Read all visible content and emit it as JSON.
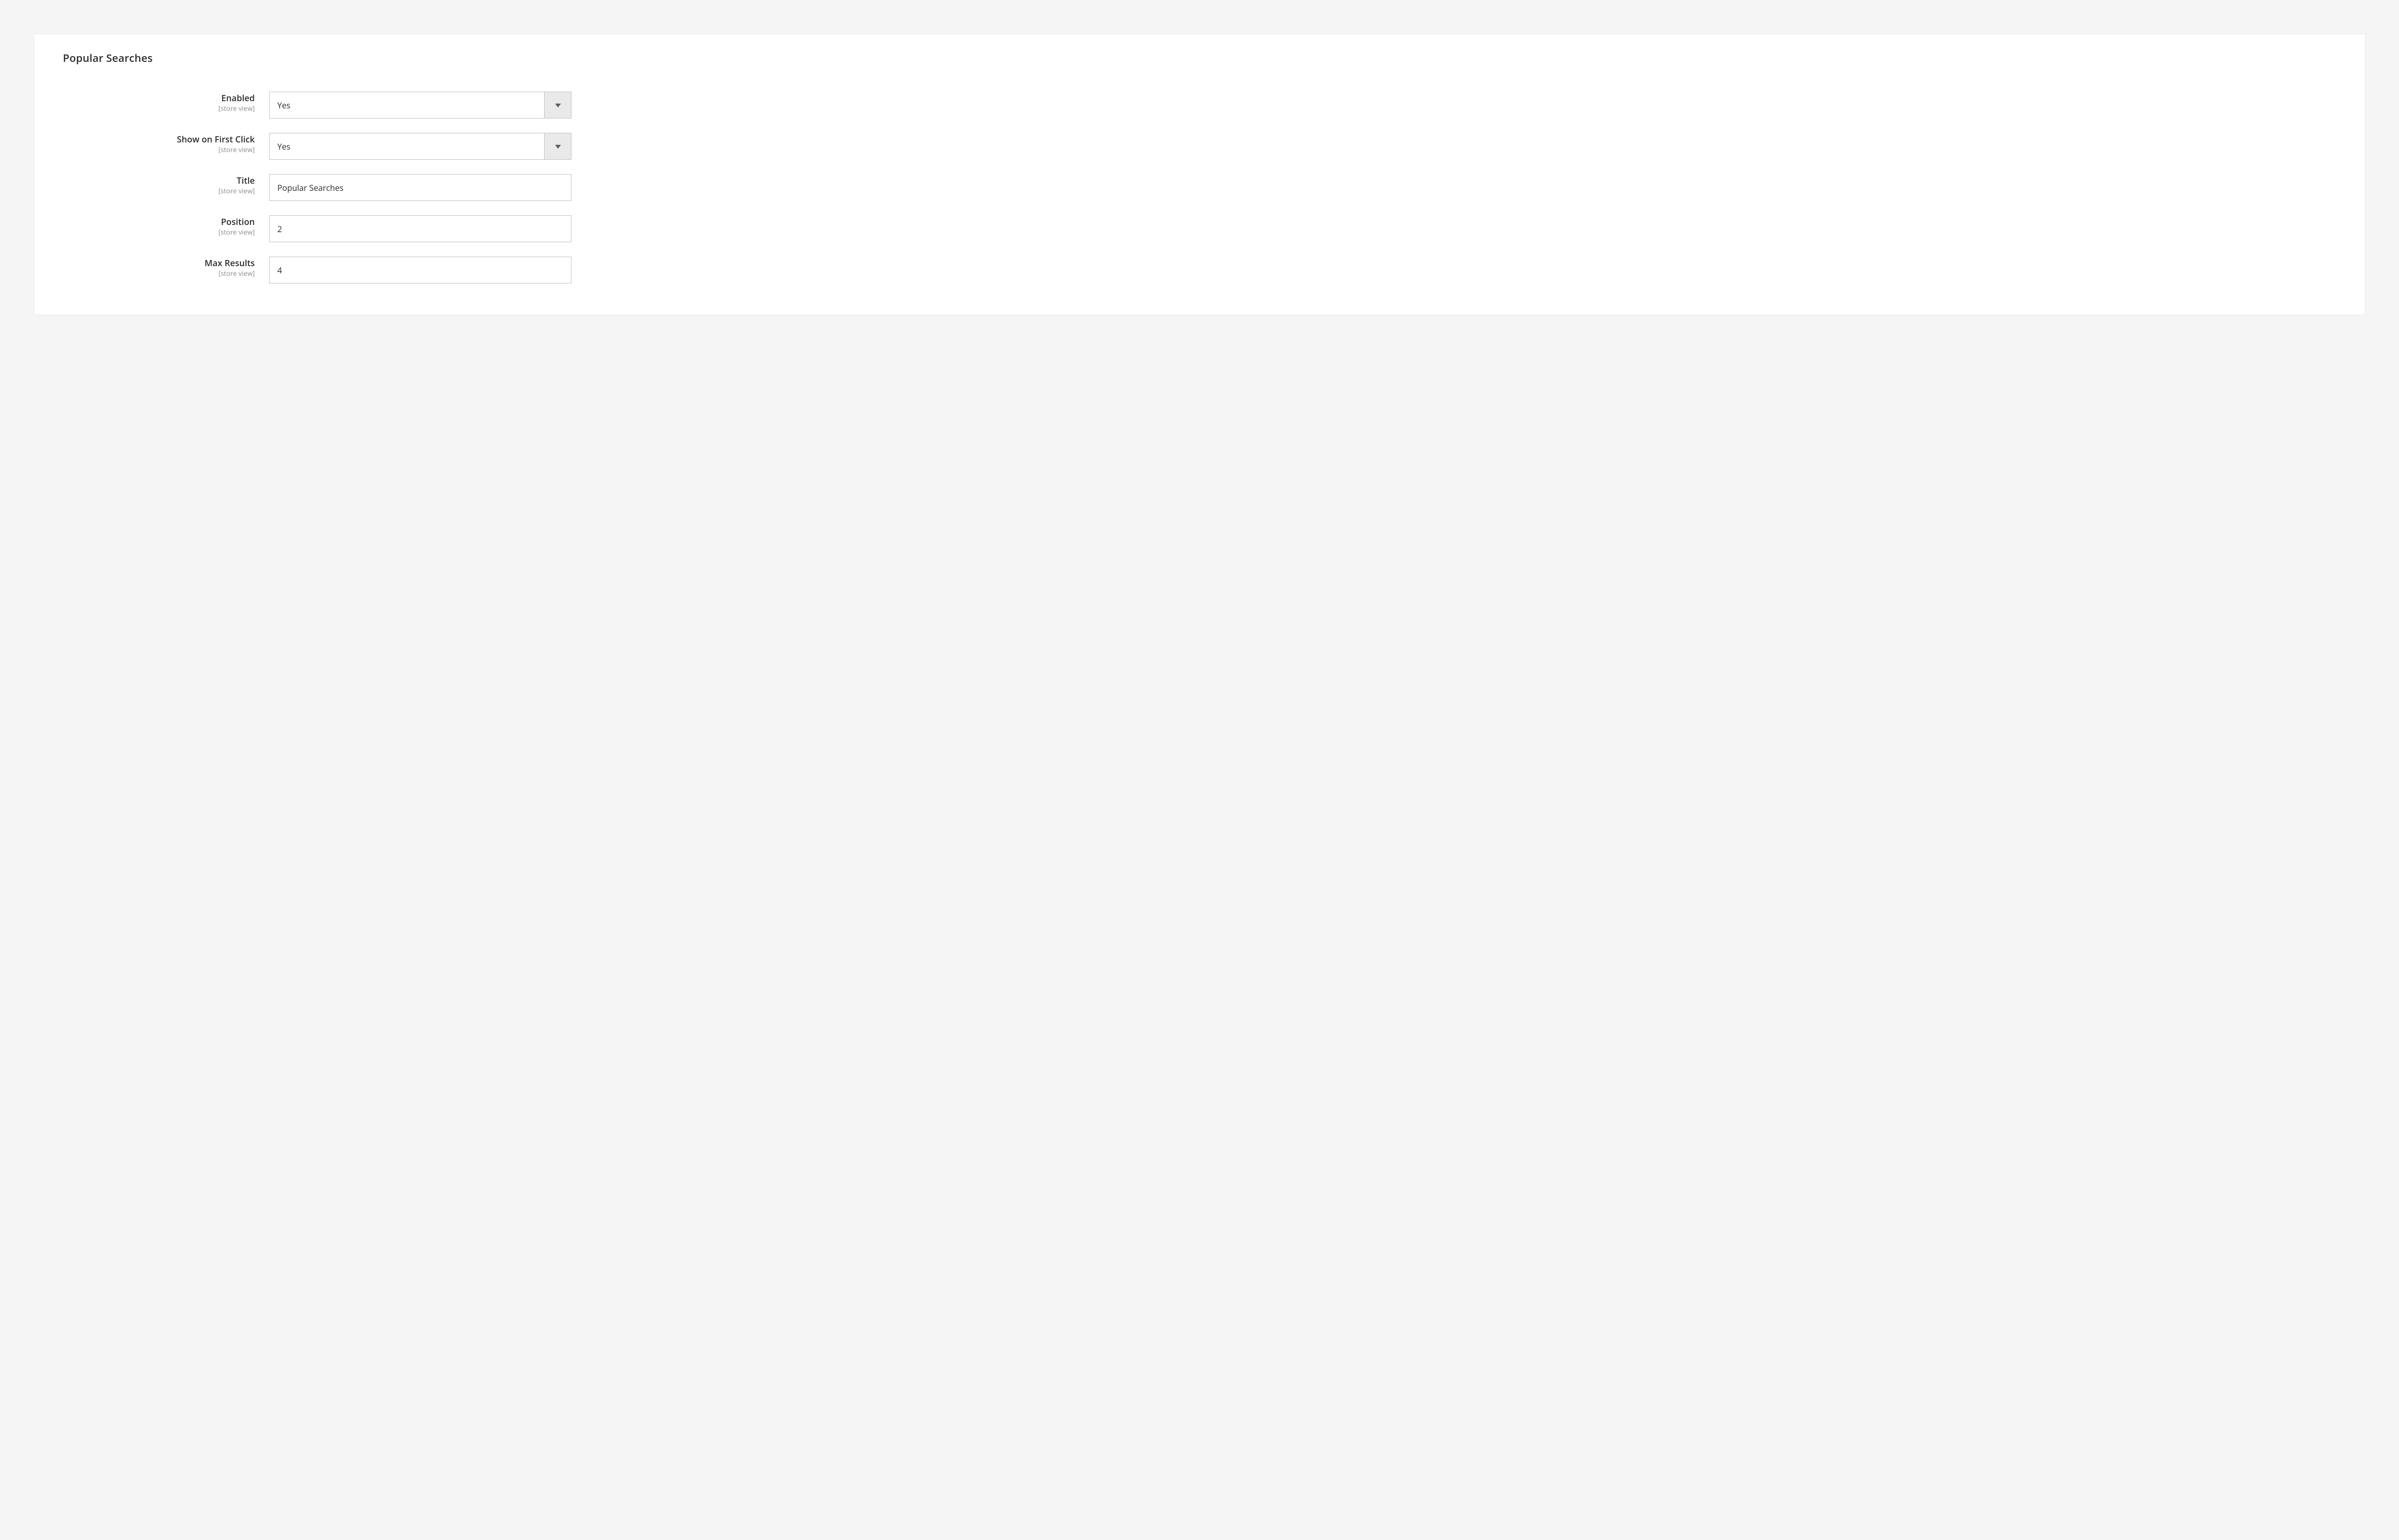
{
  "section": {
    "title": "Popular Searches",
    "scope_label": "[store view]"
  },
  "fields": {
    "enabled": {
      "label": "Enabled",
      "value": "Yes"
    },
    "show_on_first_click": {
      "label": "Show on First Click",
      "value": "Yes"
    },
    "title": {
      "label": "Title",
      "value": "Popular Searches"
    },
    "position": {
      "label": "Position",
      "value": "2"
    },
    "max_results": {
      "label": "Max Results",
      "value": "4"
    }
  }
}
